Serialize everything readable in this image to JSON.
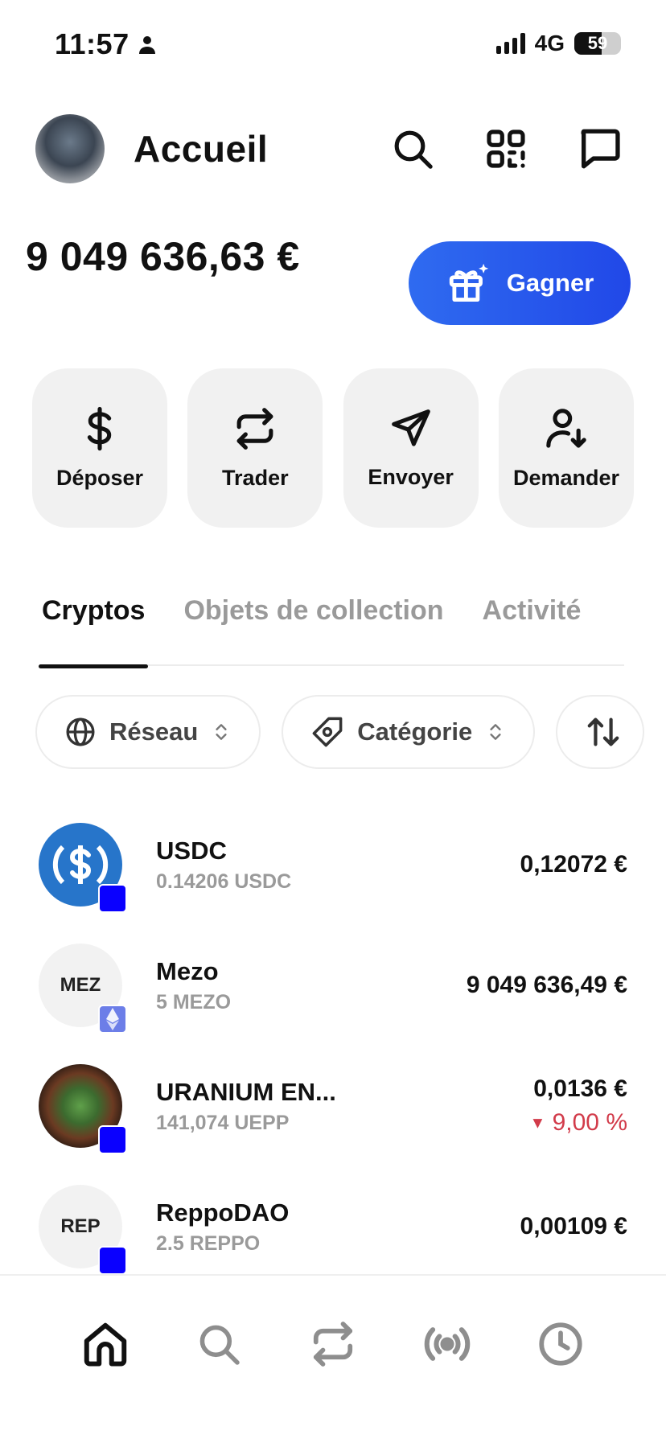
{
  "status_bar": {
    "time": "11:57",
    "network": "4G",
    "battery": "59",
    "battery_level": 0.59
  },
  "header": {
    "title": "Accueil",
    "icons": [
      "search-icon",
      "scan-icon",
      "chat-icon"
    ]
  },
  "balance": {
    "amount": "9 049 636,63 €"
  },
  "earn_button": {
    "label": "Gagner",
    "colors": [
      "#2f6bf0",
      "#2148e8"
    ]
  },
  "actions": [
    {
      "label": "Déposer",
      "icon": "dollar-icon"
    },
    {
      "label": "Trader",
      "icon": "swap-icon"
    },
    {
      "label": "Envoyer",
      "icon": "send-icon"
    },
    {
      "label": "Demander",
      "icon": "request-icon"
    }
  ],
  "tabs": [
    {
      "label": "Cryptos",
      "active": true
    },
    {
      "label": "Objets de collection",
      "active": false
    },
    {
      "label": "Activité",
      "active": false
    }
  ],
  "filters": [
    {
      "label": "Réseau",
      "icon": "globe-icon"
    },
    {
      "label": "Catégorie",
      "icon": "tag-icon"
    },
    {
      "label": "",
      "icon": "sort-icon"
    }
  ],
  "assets": [
    {
      "name": "USDC",
      "amount": "0.14206 USDC",
      "value": "0,12072 €",
      "change": "",
      "logo_text": ""
    },
    {
      "name": "Mezo",
      "amount": "5 MEZO",
      "value": "9 049 636,49 €",
      "change": "",
      "logo_text": "MEZ"
    },
    {
      "name": "URANIUM EN...",
      "amount": "141,074 UEPP",
      "value": "0,0136 €",
      "change": "9,00 %",
      "logo_text": ""
    },
    {
      "name": "ReppoDAO",
      "amount": "2.5 REPPO",
      "value": "0,00109 €",
      "change": "",
      "logo_text": "REP"
    }
  ],
  "bottom_nav": [
    "home-icon",
    "search-icon",
    "swap-icon",
    "broadcast-icon",
    "history-icon"
  ],
  "colors": {
    "accent": "#2148e8",
    "negative": "#d23b4a",
    "chain_badge": "#0a00ff"
  }
}
